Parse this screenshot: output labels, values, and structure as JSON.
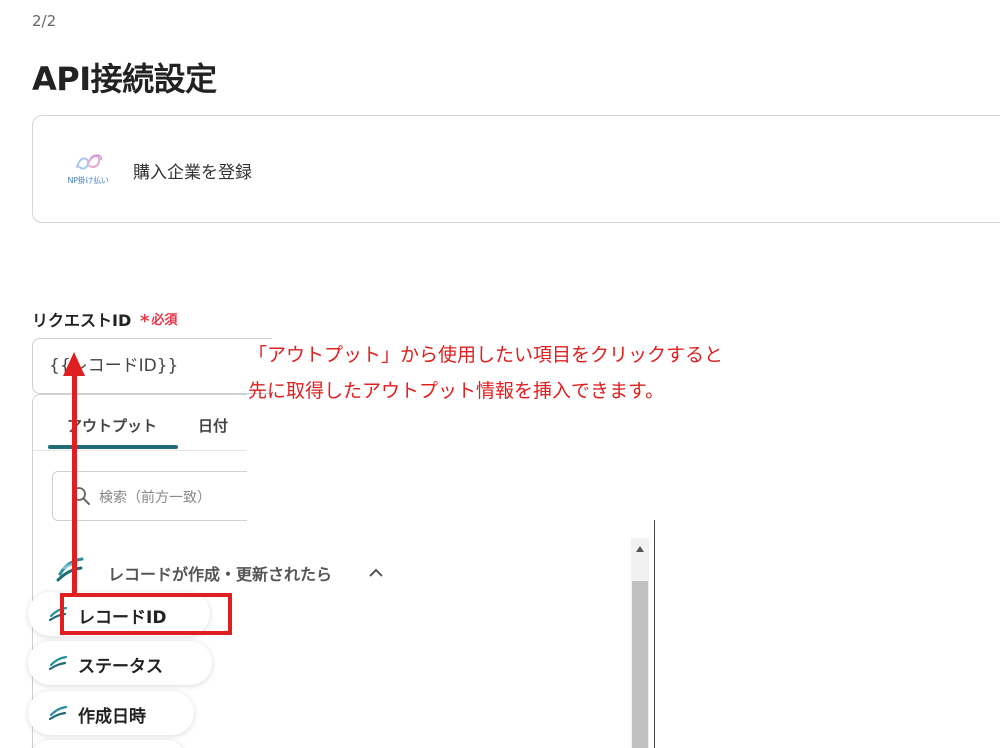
{
  "header": {
    "step": "2/2",
    "title": "API接続設定"
  },
  "app_card": {
    "logo_text": "NP掛け払い",
    "action": "購入企業を登録"
  },
  "field": {
    "label": "リクエストID",
    "required": "必須",
    "value": "{{レコードID}}"
  },
  "dropdown": {
    "tabs": [
      {
        "label": "アウトプット",
        "active": true
      },
      {
        "label": "日付",
        "active": false
      }
    ],
    "search_placeholder": "検索（前方一致）",
    "section_title": "レコードが作成・更新されたら",
    "items": [
      {
        "label": "レコードID"
      },
      {
        "label": "ステータス"
      },
      {
        "label": "作成日時"
      }
    ]
  },
  "annotation": {
    "line1": "「アウトプット」から使用したい項目をクリックすると",
    "line2": "先に取得したアウトプット情報を挿入できます。"
  },
  "colors": {
    "accent": "#1f6b78",
    "required": "#e8364a",
    "annotation": "#e02020"
  }
}
